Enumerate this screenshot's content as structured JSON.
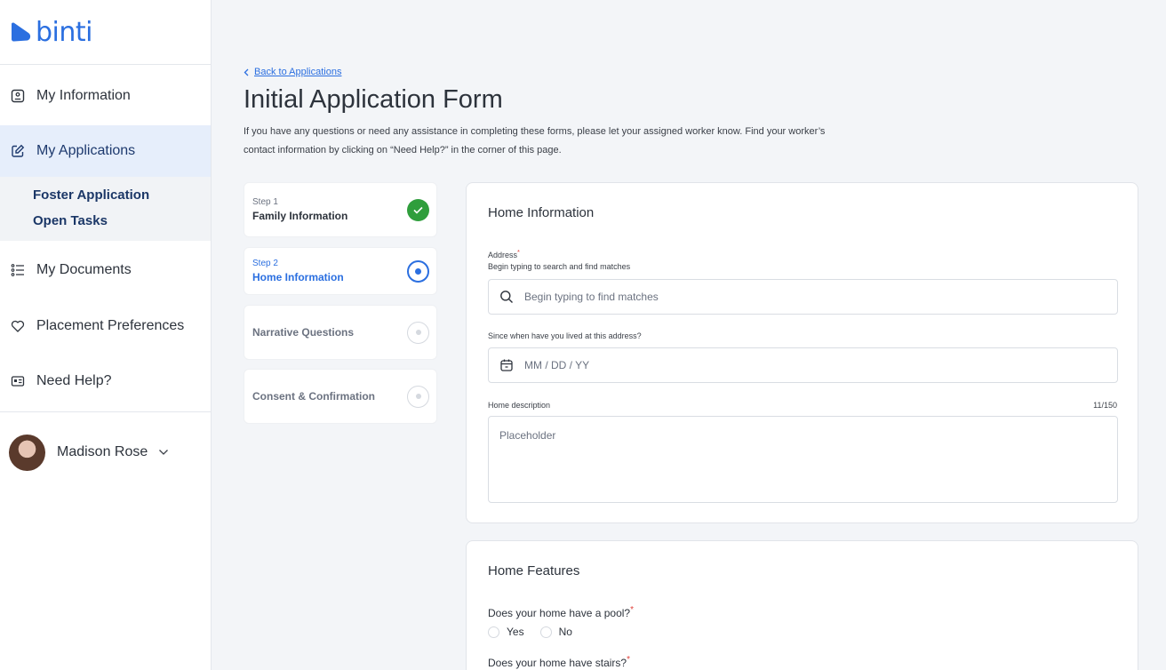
{
  "brand": {
    "name": "binti",
    "color": "#2b6fe0"
  },
  "sidebar": {
    "items": [
      {
        "label": "My Information",
        "icon": "id-badge-icon"
      },
      {
        "label": "My Applications",
        "icon": "edit-square-icon"
      },
      {
        "label": "My Documents",
        "icon": "list-icon"
      },
      {
        "label": "Placement Preferences",
        "icon": "heart-icon"
      },
      {
        "label": "Need Help?",
        "icon": "contact-card-icon"
      }
    ],
    "subitems": [
      "Foster Application",
      "Open Tasks"
    ]
  },
  "user": {
    "name": "Madison Rose"
  },
  "main": {
    "back_link": "Back to Applications",
    "title": "Initial Application Form",
    "intro": "If you have any questions or need any assistance in completing these forms, please let your assigned worker know. Find your worker’s contact information by clicking on “Need Help?” in the corner of this page."
  },
  "steps": [
    {
      "num": "Step 1",
      "name": "Family Information",
      "state": "done"
    },
    {
      "num": "Step 2",
      "name": "Home Information",
      "state": "current"
    },
    {
      "num": "",
      "name": "Narrative Questions",
      "state": "pending"
    },
    {
      "num": "",
      "name": "Consent & Confirmation",
      "state": "pending"
    }
  ],
  "home_info": {
    "title": "Home Information",
    "address_label": "Address",
    "address_hint": "Begin typing to search and find matches",
    "address_placeholder": "Begin typing to find matches",
    "since_label": "Since when have you lived at this address?",
    "since_placeholder": "MM / DD / YY",
    "desc_label": "Home description",
    "desc_counter": "11/150",
    "desc_placeholder": "Placeholder"
  },
  "home_features": {
    "title": "Home Features",
    "q1": "Does your home have a pool?",
    "yes": "Yes",
    "no": "No",
    "q2": "Does your home have stairs?"
  },
  "required_mark": "*"
}
